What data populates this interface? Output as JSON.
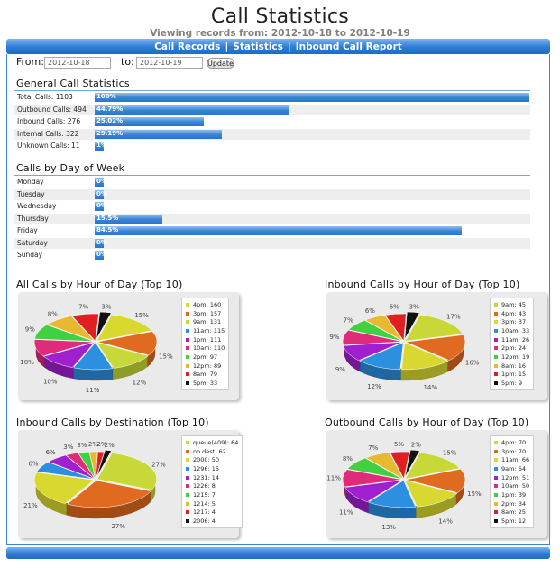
{
  "header": {
    "title": "Call Statistics",
    "subtitle": "Viewing records from: 2012-10-18 to 2012-10-19"
  },
  "nav": {
    "items": [
      "Call Records",
      "Statistics",
      "Inbound Call Report"
    ],
    "separator": "|"
  },
  "filter": {
    "from_label": "From:",
    "from_value": "2012-10-18",
    "to_label": "to:",
    "to_value": "2012-10-19",
    "update_label": "Update"
  },
  "general": {
    "title": "General Call Statistics",
    "rows": [
      {
        "label": "Total Calls: 1103",
        "pct": "100%",
        "value": 100
      },
      {
        "label": "Outbound Calls: 494",
        "pct": "44.79%",
        "value": 44.79
      },
      {
        "label": "Inbound Calls: 276",
        "pct": "25.02%",
        "value": 25.02
      },
      {
        "label": "Internal Calls: 322",
        "pct": "29.19%",
        "value": 29.19
      },
      {
        "label": "Unknown Calls: 11",
        "pct": "1%",
        "value": 1
      }
    ]
  },
  "weekday": {
    "title": "Calls by Day of Week",
    "rows": [
      {
        "label": "Monday",
        "pct": "0%",
        "value": 0
      },
      {
        "label": "Tuesday",
        "pct": "0%",
        "value": 0
      },
      {
        "label": "Wednesday",
        "pct": "0%",
        "value": 0
      },
      {
        "label": "Thursday",
        "pct": "15.5%",
        "value": 15.5
      },
      {
        "label": "Friday",
        "pct": "84.5%",
        "value": 84.5
      },
      {
        "label": "Saturday",
        "pct": "0%",
        "value": 0
      },
      {
        "label": "Sunday",
        "pct": "0%",
        "value": 0
      }
    ]
  },
  "colors": [
    "#d8d830",
    "#e8a020",
    "#d8d830",
    "#2090e0",
    "#e87a20",
    "#a020d0",
    "#30d040",
    "#e8b830",
    "#e02040",
    "#111111"
  ],
  "chart_data": [
    {
      "type": "pie",
      "title": "All Calls by Hour of Day (Top 10)",
      "legend": [
        "4pm: 160",
        "3pm: 157",
        "9am: 131",
        "11am: 115",
        "1pm: 111",
        "10am: 110",
        "2pm: 97",
        "12pm: 89",
        "8am: 79",
        "5pm: 33"
      ],
      "values": [
        160,
        157,
        131,
        115,
        111,
        110,
        97,
        89,
        79,
        33
      ],
      "slice_labels": [
        "15%",
        "15%",
        "12%",
        "11%",
        "10%",
        "10%",
        "9%",
        "8%",
        "7%",
        "3%"
      ],
      "colors": [
        "#d8d830",
        "#e06a20",
        "#c8d838",
        "#2c8fe0",
        "#a020d0",
        "#e02a7a",
        "#40d040",
        "#e8b830",
        "#e02020",
        "#111111"
      ]
    },
    {
      "type": "pie",
      "title": "Inbound Calls by Hour of Day (Top 10)",
      "legend": [
        "9am: 45",
        "4pm: 43",
        "3pm: 37",
        "10am: 33",
        "11am: 26",
        "2pm: 24",
        "12pm: 19",
        "8am: 16",
        "1pm: 15",
        "5pm: 9"
      ],
      "values": [
        45,
        43,
        37,
        33,
        26,
        24,
        19,
        16,
        15,
        9
      ],
      "slice_labels": [
        "17%",
        "16%",
        "14%",
        "12%",
        "9%",
        "9%",
        "7%",
        "6%",
        "6%",
        "3%"
      ],
      "colors": [
        "#c8d838",
        "#e06a20",
        "#d8d830",
        "#2c8fe0",
        "#a020d0",
        "#e02a7a",
        "#40d040",
        "#e8b830",
        "#e02020",
        "#111111"
      ]
    },
    {
      "type": "pie",
      "title": "Inbound Calls by Destination (Top 10)",
      "legend": [
        "queue(409): 64",
        "no dest: 62",
        "2000: 50",
        "1296: 15",
        "1231: 14",
        "1226: 8",
        "1215: 7",
        "1214: 5",
        "1217: 4",
        "2006: 4"
      ],
      "values": [
        64,
        62,
        50,
        15,
        14,
        8,
        7,
        5,
        4,
        4
      ],
      "slice_labels": [
        "27%",
        "27%",
        "21%",
        "6%",
        "6%",
        "3%",
        "3%",
        "2%",
        "2%",
        "2%"
      ],
      "colors": [
        "#c8d838",
        "#e06a20",
        "#d8d830",
        "#2c8fe0",
        "#a020d0",
        "#e02a7a",
        "#40d040",
        "#e8b830",
        "#e02020",
        "#111111"
      ]
    },
    {
      "type": "pie",
      "title": "Outbound Calls by Hour of Day (Top 10)",
      "legend": [
        "4pm: 70",
        "3pm: 70",
        "11am: 66",
        "9am: 64",
        "12pm: 51",
        "10am: 50",
        "1pm: 39",
        "2pm: 34",
        "8am: 25",
        "5pm: 12"
      ],
      "values": [
        70,
        70,
        66,
        64,
        51,
        50,
        39,
        34,
        25,
        12
      ],
      "slice_labels": [
        "15%",
        "15%",
        "14%",
        "13%",
        "11%",
        "11%",
        "8%",
        "7%",
        "5%",
        "2%"
      ],
      "colors": [
        "#c8d838",
        "#e06a20",
        "#d8d830",
        "#2c8fe0",
        "#a020d0",
        "#e02a7a",
        "#40d040",
        "#e8b830",
        "#e02020",
        "#111111"
      ]
    }
  ]
}
